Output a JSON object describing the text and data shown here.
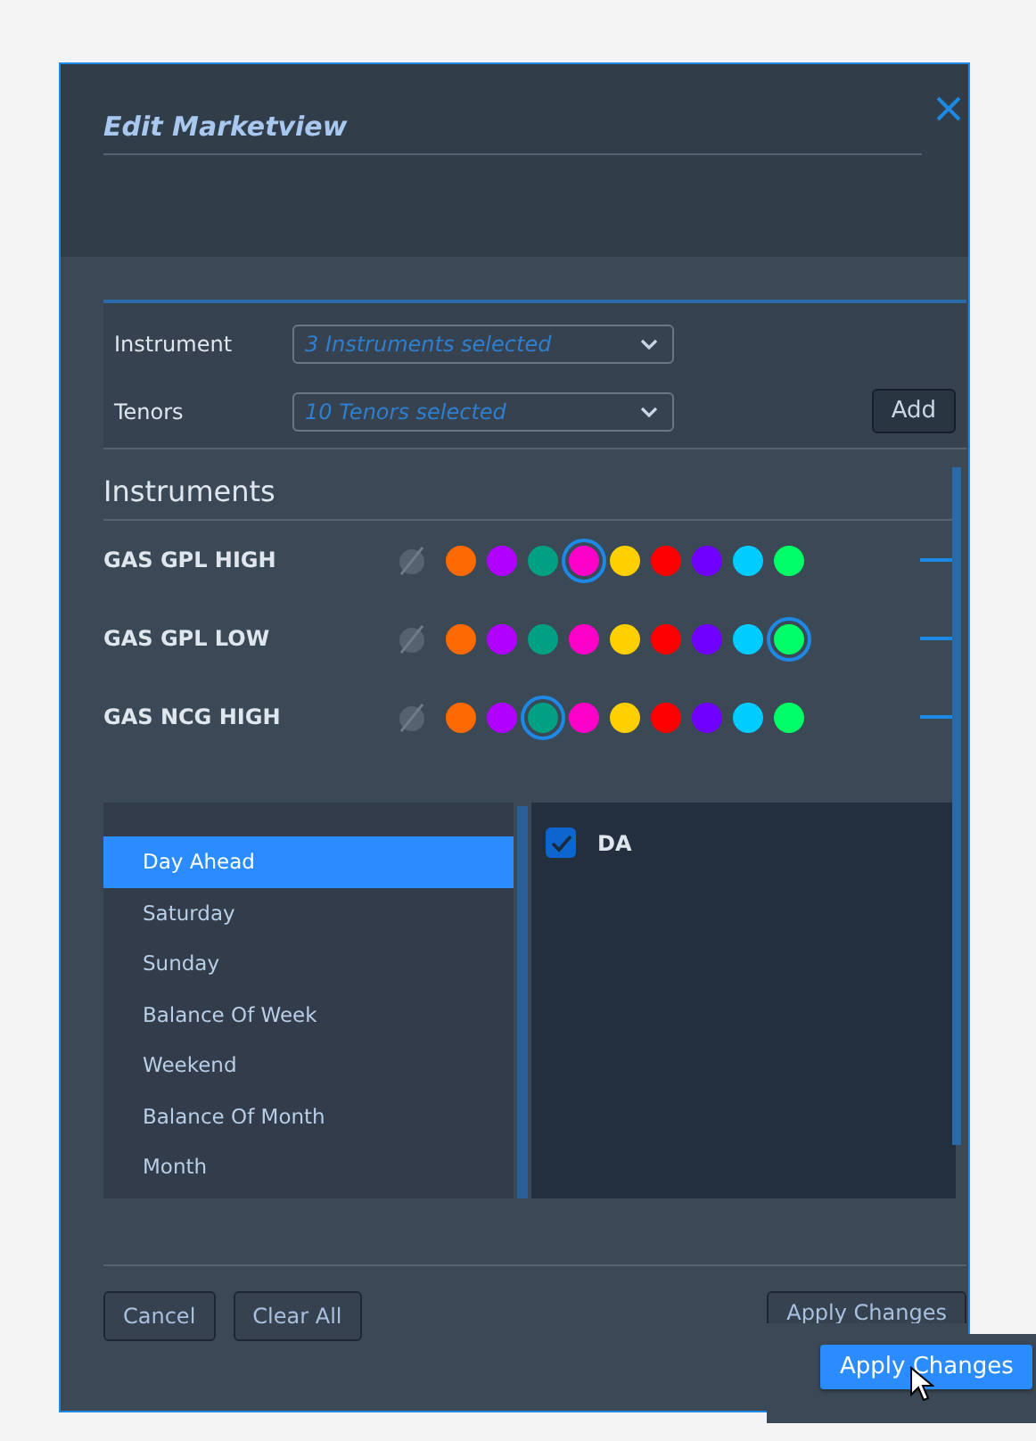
{
  "dialog": {
    "title": "Edit Marketview"
  },
  "filters": [
    {
      "label": "Instrument",
      "value": "3 Instruments selected"
    },
    {
      "label": "Tenors",
      "value": "10 Tenors selected"
    }
  ],
  "add_button": "Add",
  "instruments": {
    "title": "Instruments",
    "rows": [
      {
        "name": "GAS GPL HIGH",
        "swatches": [
          {
            "color": "#ff6a00",
            "selected": false
          },
          {
            "color": "#b000ff",
            "selected": false
          },
          {
            "color": "#00a085",
            "selected": false
          },
          {
            "color": "#ff00c8",
            "selected": true
          },
          {
            "color": "#ffd000",
            "selected": false
          },
          {
            "color": "#ff0000",
            "selected": false
          },
          {
            "color": "#7000ff",
            "selected": false
          },
          {
            "color": "#00ccff",
            "selected": false
          },
          {
            "color": "#00ff66",
            "selected": false
          }
        ]
      },
      {
        "name": "GAS GPL LOW",
        "swatches": [
          {
            "color": "#ff6a00",
            "selected": false
          },
          {
            "color": "#b000ff",
            "selected": false
          },
          {
            "color": "#00a085",
            "selected": false
          },
          {
            "color": "#ff00c8",
            "selected": false
          },
          {
            "color": "#ffd000",
            "selected": false
          },
          {
            "color": "#ff0000",
            "selected": false
          },
          {
            "color": "#7000ff",
            "selected": false
          },
          {
            "color": "#00ccff",
            "selected": false
          },
          {
            "color": "#00ff66",
            "selected": true
          }
        ]
      },
      {
        "name": "GAS NCG HIGH",
        "swatches": [
          {
            "color": "#ff6a00",
            "selected": false
          },
          {
            "color": "#b000ff",
            "selected": false
          },
          {
            "color": "#00a085",
            "selected": true
          },
          {
            "color": "#ff00c8",
            "selected": false
          },
          {
            "color": "#ffd000",
            "selected": false
          },
          {
            "color": "#ff0000",
            "selected": false
          },
          {
            "color": "#7000ff",
            "selected": false
          },
          {
            "color": "#00ccff",
            "selected": false
          },
          {
            "color": "#00ff66",
            "selected": false
          }
        ]
      }
    ]
  },
  "tenors": [
    {
      "label": "Day Ahead",
      "selected": true
    },
    {
      "label": "Saturday",
      "selected": false
    },
    {
      "label": "Sunday",
      "selected": false
    },
    {
      "label": "Balance Of Week",
      "selected": false
    },
    {
      "label": "Weekend",
      "selected": false
    },
    {
      "label": "Balance Of Month",
      "selected": false
    },
    {
      "label": "Month",
      "selected": false
    }
  ],
  "tenor_options": [
    {
      "label": "DA",
      "checked": true
    }
  ],
  "buttons": [
    "Cancel",
    "Clear All",
    "Apply Changes"
  ],
  "inset_button": "Apply Changes"
}
